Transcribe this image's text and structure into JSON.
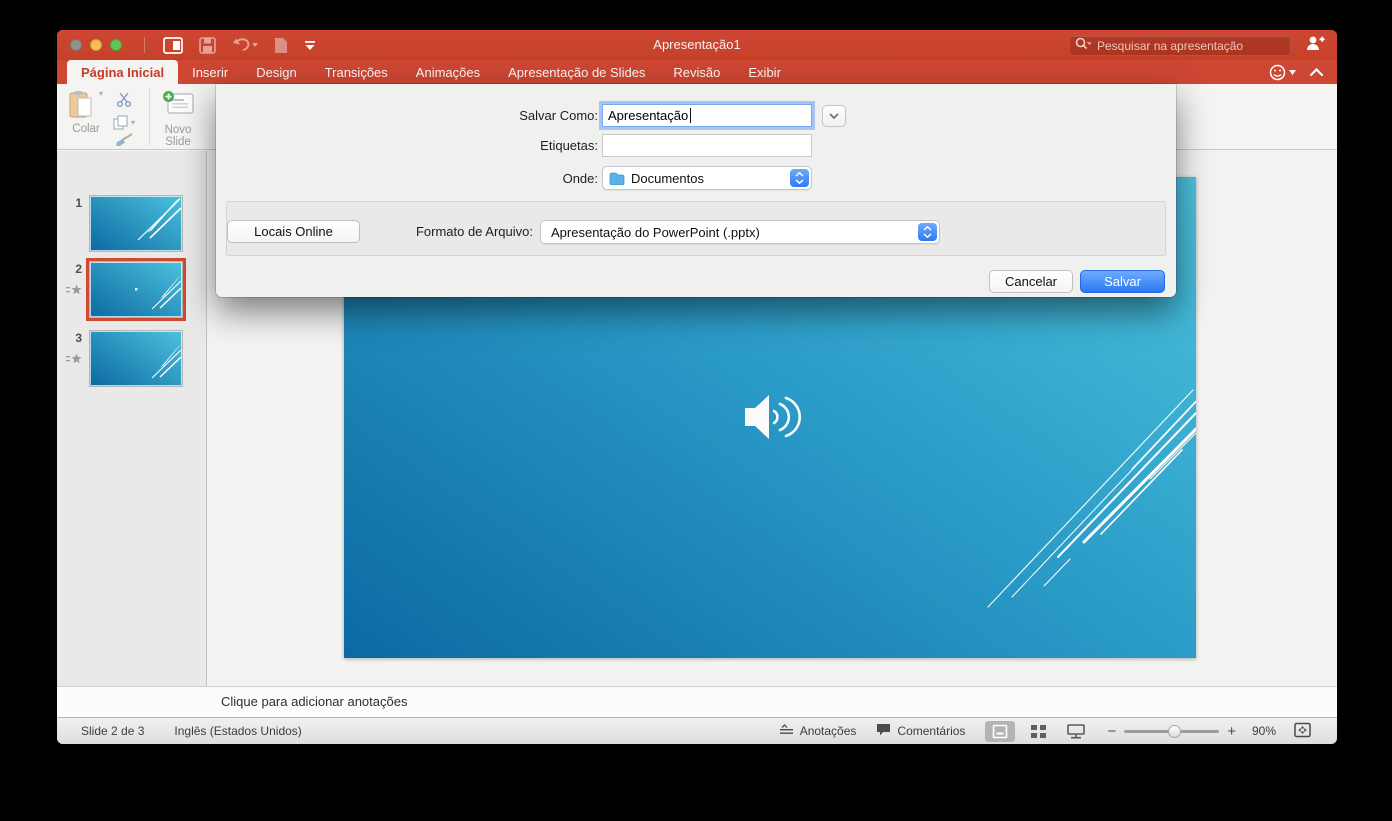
{
  "colors": {
    "accent": "#cd4733",
    "accent-text": "#c23c26",
    "save-blue": "#2e7bf4",
    "slide-light": "#4cc2dd",
    "slide-dark": "#0c69a2",
    "selection": "#ce4a30"
  },
  "titlebar": {
    "title": "Apresentação1",
    "search_placeholder": "Pesquisar na apresentação"
  },
  "tabs": [
    {
      "label": "Página Inicial"
    },
    {
      "label": "Inserir"
    },
    {
      "label": "Design"
    },
    {
      "label": "Transições"
    },
    {
      "label": "Animações"
    },
    {
      "label": "Apresentação de Slides"
    },
    {
      "label": "Revisão"
    },
    {
      "label": "Exibir"
    }
  ],
  "ribbon": {
    "paste_label": "Colar",
    "new_slide_label": "Novo Slide"
  },
  "dialog": {
    "save_as_label": "Salvar Como:",
    "save_as_value": "Apresentação",
    "tags_label": "Etiquetas:",
    "tags_value": "",
    "where_label": "Onde:",
    "where_value": "Documentos",
    "online_locations_label": "Locais Online",
    "file_format_label": "Formato de Arquivo:",
    "file_format_value": "Apresentação do PowerPoint (.pptx)",
    "cancel_label": "Cancelar",
    "save_label": "Salvar"
  },
  "sidebar": {
    "slides": [
      {
        "number": "1"
      },
      {
        "number": "2"
      },
      {
        "number": "3"
      }
    ]
  },
  "notes": {
    "placeholder": "Clique para adicionar anotações"
  },
  "statusbar": {
    "slide_indicator": "Slide 2 de 3",
    "language": "Inglês (Estados Unidos)",
    "notes_label": "Anotações",
    "comments_label": "Comentários",
    "zoom_level": "90%"
  }
}
